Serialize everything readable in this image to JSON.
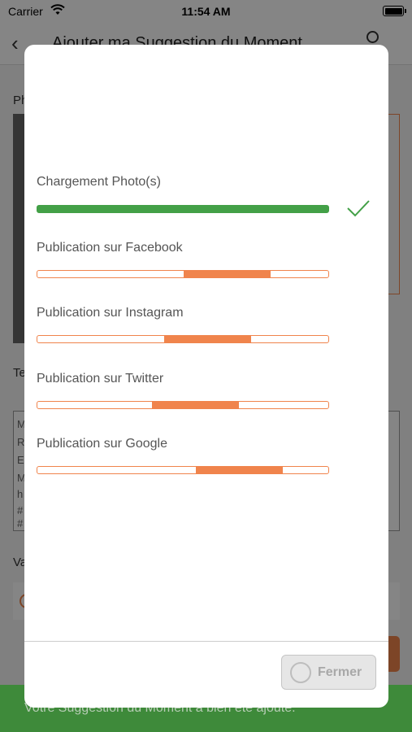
{
  "status_bar": {
    "carrier": "Carrier",
    "time": "11:54 AM"
  },
  "background_screen": {
    "title": "Ajouter ma Suggestion du Moment",
    "section_photo_label": "Ph",
    "section_text_label": "Te",
    "section_value_label": "Va",
    "text_lines": [
      "M",
      "R",
      "E",
      "M",
      "h",
      "#",
      "#"
    ],
    "toast_message": "Votre Suggestion du Moment a bien été ajouté."
  },
  "upload_modal": {
    "steps": [
      {
        "label": "Chargement Photo(s)",
        "status": "complete",
        "progress": 1.0
      },
      {
        "label": "Publication sur Facebook",
        "status": "in-progress"
      },
      {
        "label": "Publication sur Instagram",
        "status": "in-progress"
      },
      {
        "label": "Publication sur Twitter",
        "status": "in-progress"
      },
      {
        "label": "Publication sur Google",
        "status": "in-progress"
      }
    ],
    "close_button_label": "Fermer",
    "close_button_enabled": false
  },
  "colors": {
    "accent_orange": "#f0844c",
    "success_green": "#43a047",
    "toast_green": "#3e8a3a"
  }
}
